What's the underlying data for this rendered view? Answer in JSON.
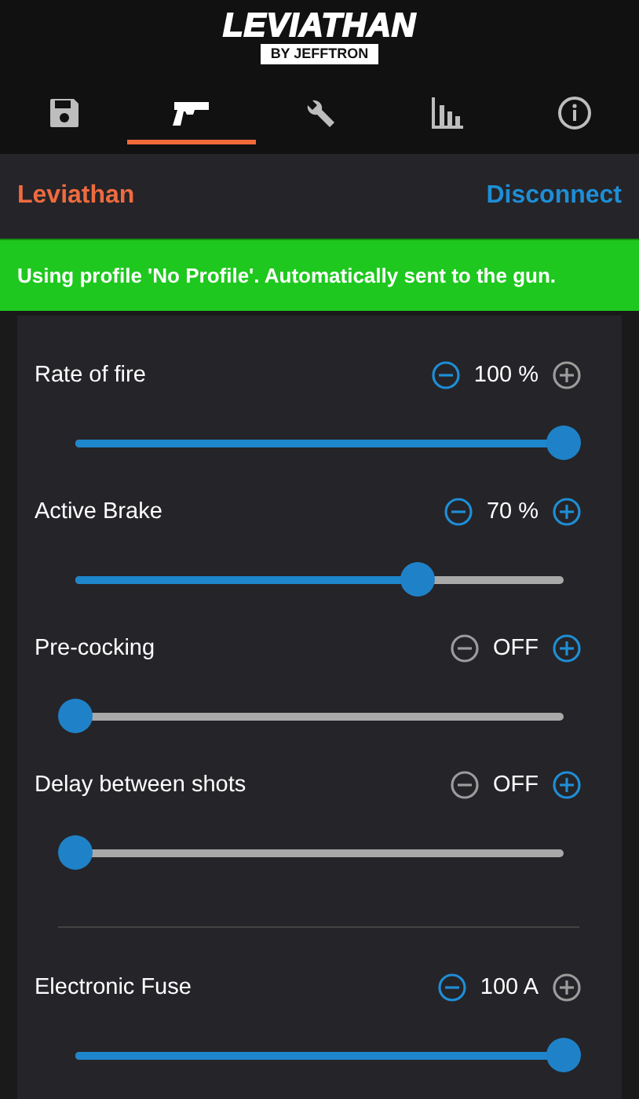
{
  "logo": {
    "title": "LEVIATHAN",
    "subtitle": "BY JEFFTRON"
  },
  "tabs": [
    {
      "selected": false
    },
    {
      "selected": true
    },
    {
      "selected": false
    },
    {
      "selected": false
    },
    {
      "selected": false
    }
  ],
  "device_bar": {
    "name": "Leviathan",
    "action": "Disconnect"
  },
  "banner": "Using profile 'No Profile'. Automatically sent to the gun.",
  "groups": [
    {
      "settings": [
        {
          "label": "Rate of fire",
          "value": "100 %",
          "level": 1,
          "minus_enabled": true,
          "plus_enabled": false
        },
        {
          "label": "Active Brake",
          "value": "70 %",
          "level": 0.7,
          "minus_enabled": true,
          "plus_enabled": true
        },
        {
          "label": "Pre-cocking",
          "value": "OFF",
          "level": 0,
          "minus_enabled": false,
          "plus_enabled": true
        },
        {
          "label": "Delay between shots",
          "value": "OFF",
          "level": 0,
          "minus_enabled": false,
          "plus_enabled": true
        }
      ]
    },
    {
      "settings": [
        {
          "label": "Electronic Fuse",
          "value": "100 A",
          "level": 1,
          "minus_enabled": true,
          "plus_enabled": false
        }
      ]
    }
  ]
}
